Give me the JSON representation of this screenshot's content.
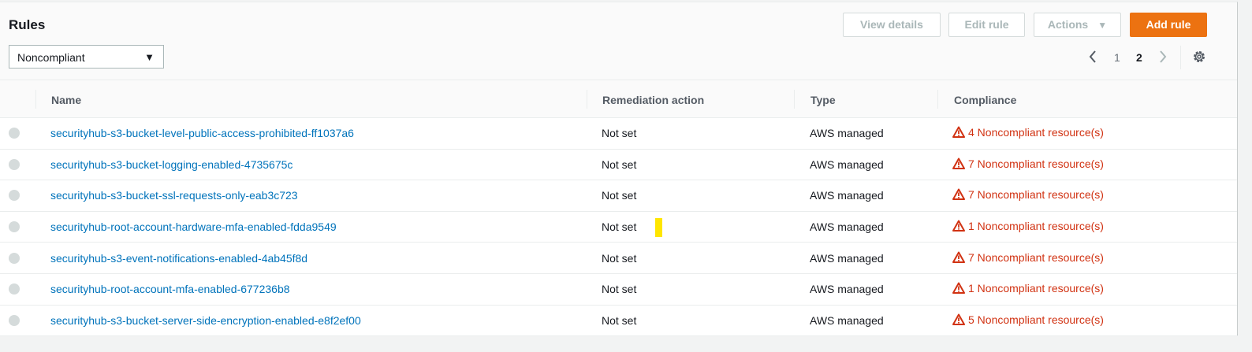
{
  "header": {
    "title": "Rules",
    "filter": {
      "selected": "Noncompliant"
    }
  },
  "toolbar": {
    "view_details": "View details",
    "edit_rule": "Edit rule",
    "actions": "Actions",
    "add_rule": "Add rule"
  },
  "pagination": {
    "pages": [
      "1",
      "2"
    ],
    "current": "2"
  },
  "colors": {
    "accent": "#ec7211",
    "link": "#0073bb",
    "error": "#d13212"
  },
  "table": {
    "columns": [
      "Name",
      "Remediation action",
      "Type",
      "Compliance"
    ],
    "rows": [
      {
        "name": "securityhub-s3-bucket-level-public-access-prohibited-ff1037a6",
        "remediation": "Not set",
        "type": "AWS managed",
        "compliance": "4 Noncompliant resource(s)"
      },
      {
        "name": "securityhub-s3-bucket-logging-enabled-4735675c",
        "remediation": "Not set",
        "type": "AWS managed",
        "compliance": "7 Noncompliant resource(s)"
      },
      {
        "name": "securityhub-s3-bucket-ssl-requests-only-eab3c723",
        "remediation": "Not set",
        "type": "AWS managed",
        "compliance": "7 Noncompliant resource(s)"
      },
      {
        "name": "securityhub-root-account-hardware-mfa-enabled-fdda9549",
        "remediation": "Not set",
        "type": "AWS managed",
        "compliance": "1 Noncompliant resource(s)"
      },
      {
        "name": "securityhub-s3-event-notifications-enabled-4ab45f8d",
        "remediation": "Not set",
        "type": "AWS managed",
        "compliance": "7 Noncompliant resource(s)"
      },
      {
        "name": "securityhub-root-account-mfa-enabled-677236b8",
        "remediation": "Not set",
        "type": "AWS managed",
        "compliance": "1 Noncompliant resource(s)"
      },
      {
        "name": "securityhub-s3-bucket-server-side-encryption-enabled-e8f2ef00",
        "remediation": "Not set",
        "type": "AWS managed",
        "compliance": "5 Noncompliant resource(s)"
      }
    ]
  }
}
